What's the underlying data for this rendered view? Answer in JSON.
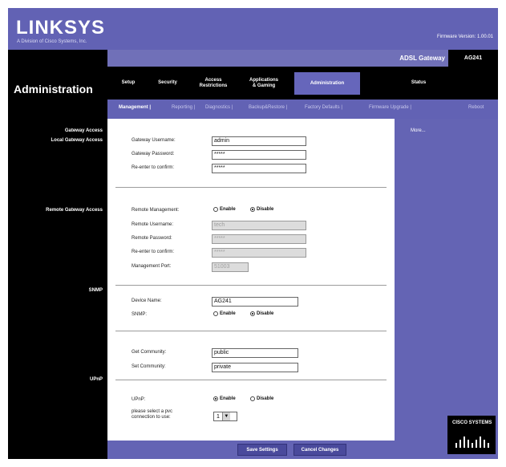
{
  "brand": {
    "logo": "LINKSYS",
    "sub": "A Division of Cisco Systems, Inc.",
    "firmware": "Firmware Version: 1.00.01"
  },
  "page_title": "Administration",
  "product": {
    "name": "ADSL Gateway",
    "model": "AG241"
  },
  "tabs": [
    {
      "label": "Setup"
    },
    {
      "label": "Security"
    },
    {
      "label": "Access\nRestrictions"
    },
    {
      "label": "Applications\n& Gaming"
    },
    {
      "label": "Administration"
    },
    {
      "label": "Status"
    }
  ],
  "subtabs": [
    {
      "label": "Management |"
    },
    {
      "label": "Reporting |"
    },
    {
      "label": "Diagnostics |"
    },
    {
      "label": "Backup&Restore |"
    },
    {
      "label": "Factory Defaults |"
    },
    {
      "label": "Firmware Upgrade |"
    },
    {
      "label": "Reboot"
    }
  ],
  "sidebar": {
    "gateway_access": "Gateway Access",
    "local_access": "Local Gateway Access",
    "remote_access": "Remote Gateway Access",
    "snmp": "SNMP",
    "upnp": "UPnP"
  },
  "help": {
    "label": "More..."
  },
  "local": {
    "username_label": "Gateway Username:",
    "username_value": "admin",
    "password_label": "Gateway Password:",
    "password_value": "*****",
    "reenter_label": "Re-enter to confirm:",
    "reenter_value": "*****"
  },
  "remote": {
    "management_label": "Remote Management:",
    "enable": "Enable",
    "disable": "Disable",
    "username_label": "Remote Username:",
    "username_value": "tech",
    "password_label": "Remote Password:",
    "password_value": "*****",
    "reenter_label": "Re-enter to confirm:",
    "reenter_value": "*****",
    "port_label": "Management Port:",
    "port_value": "51003"
  },
  "snmp": {
    "device_label": "Device Name:",
    "device_value": "AG241",
    "snmp_label": "SNMP:",
    "enable": "Enable",
    "disable": "Disable",
    "get_label": "Get Community:",
    "get_value": "public",
    "set_label": "Set Community:",
    "set_value": "private"
  },
  "upnp": {
    "upnp_label": "UPnP:",
    "enable": "Enable",
    "disable": "Disable",
    "select_label": "please select a pvc\nconnection to use:",
    "select_value": "1"
  },
  "buttons": {
    "save": "Save Settings",
    "cancel": "Cancel Changes"
  },
  "cisco_logo": "CISCO SYSTEMS",
  "colors": {
    "purple": "#6262b4",
    "black": "#000000",
    "white": "#ffffff"
  }
}
